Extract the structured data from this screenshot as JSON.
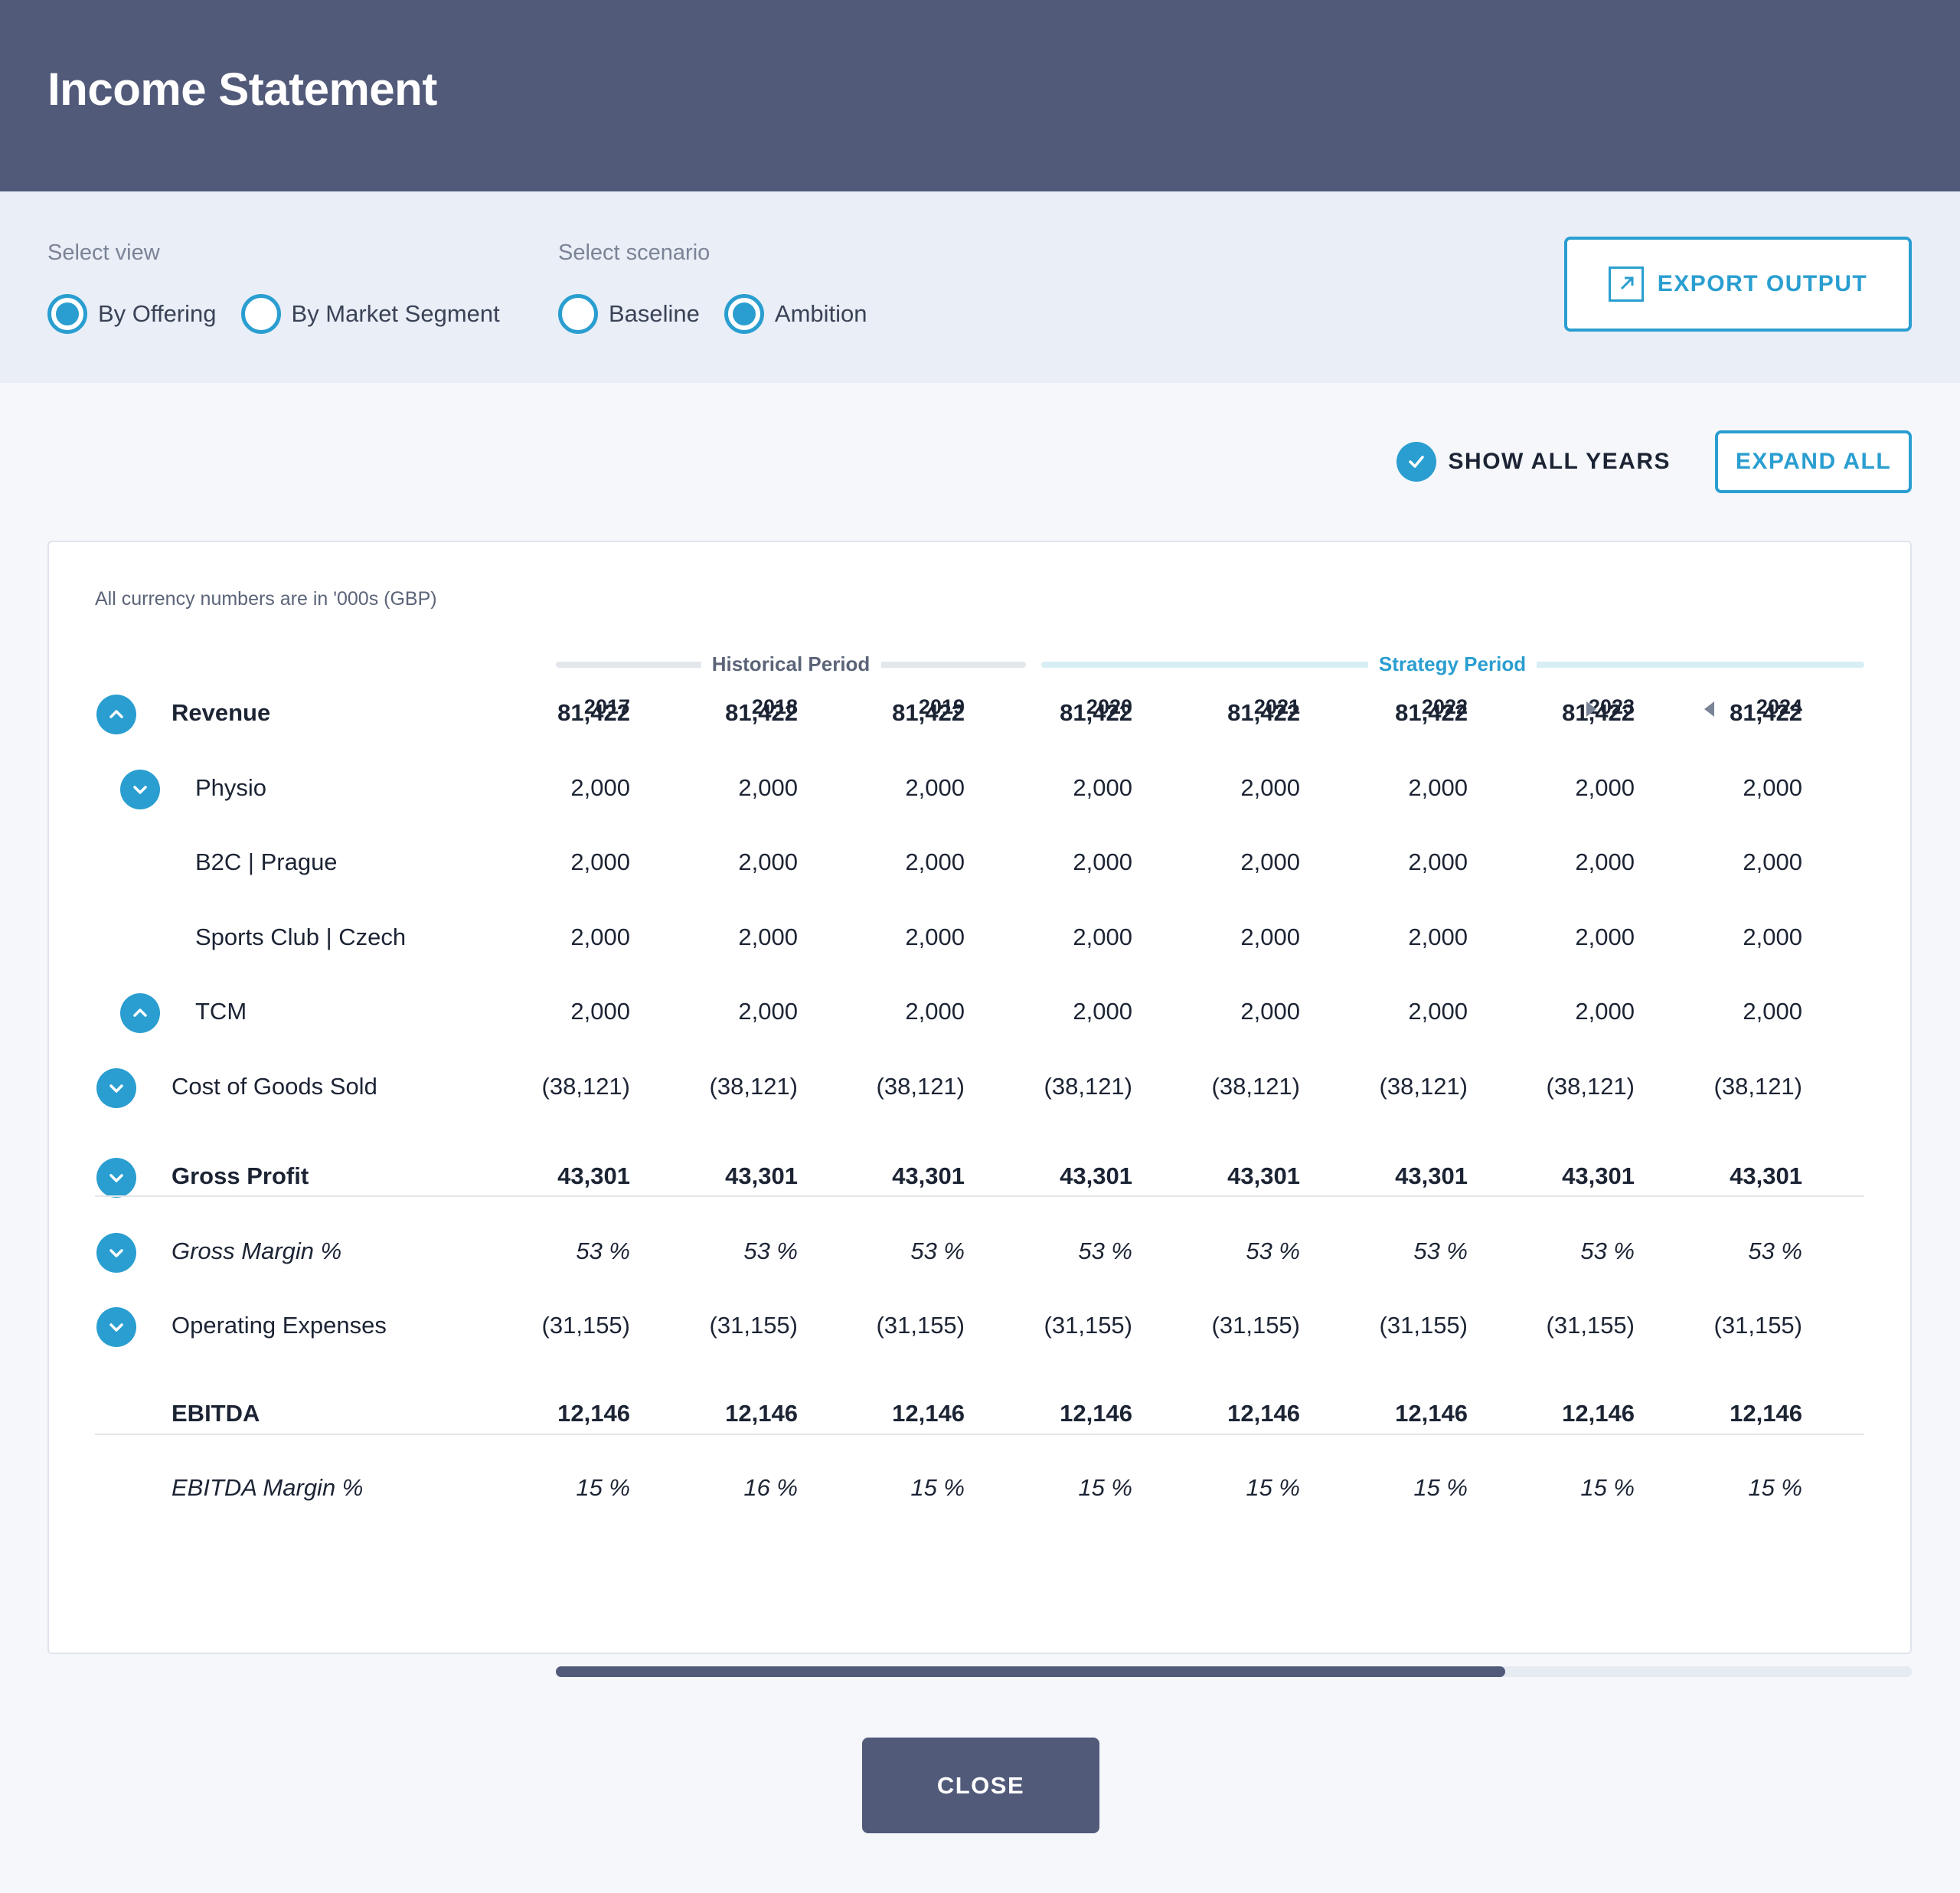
{
  "header": {
    "title": "Income Statement"
  },
  "controls": {
    "view_label": "Select view",
    "view_options": [
      {
        "label": "By Offering",
        "selected": true
      },
      {
        "label": "By Market Segment",
        "selected": false
      }
    ],
    "scenario_label": "Select scenario",
    "scenario_options": [
      {
        "label": "Baseline",
        "selected": false
      },
      {
        "label": "Ambition",
        "selected": true
      }
    ],
    "export_label": "EXPORT OUTPUT"
  },
  "toolbar": {
    "show_all_years_label": "SHOW ALL YEARS",
    "show_all_years_checked": true,
    "expand_all_label": "EXPAND ALL"
  },
  "table": {
    "currency_note": "All currency numbers are in '000s (GBP)",
    "historical_label": "Historical Period",
    "strategy_label": "Strategy Period",
    "years": [
      "2017",
      "2018",
      "2019",
      "2020",
      "2021",
      "2022",
      "2023",
      "2024"
    ],
    "rows": [
      {
        "label": "Revenue",
        "toggle": "collapse",
        "style": "bold",
        "values": [
          "81,422",
          "81,422",
          "81,422",
          "81,422",
          "81,422",
          "81,422",
          "81,422",
          "81,422"
        ]
      },
      {
        "label": "Physio",
        "toggle": "expand",
        "style": "normal",
        "values": [
          "2,000",
          "2,000",
          "2,000",
          "2,000",
          "2,000",
          "2,000",
          "2,000",
          "2,000"
        ]
      },
      {
        "label": "B2C | Prague",
        "toggle": "none",
        "style": "normal",
        "values": [
          "2,000",
          "2,000",
          "2,000",
          "2,000",
          "2,000",
          "2,000",
          "2,000",
          "2,000"
        ]
      },
      {
        "label": "Sports Club | Czech",
        "toggle": "none",
        "style": "normal",
        "values": [
          "2,000",
          "2,000",
          "2,000",
          "2,000",
          "2,000",
          "2,000",
          "2,000",
          "2,000"
        ]
      },
      {
        "label": "TCM",
        "toggle": "collapse",
        "style": "normal",
        "values": [
          "2,000",
          "2,000",
          "2,000",
          "2,000",
          "2,000",
          "2,000",
          "2,000",
          "2,000"
        ]
      },
      {
        "label": "Cost of Goods Sold",
        "toggle": "expand",
        "style": "normal",
        "values": [
          "(38,121)",
          "(38,121)",
          "(38,121)",
          "(38,121)",
          "(38,121)",
          "(38,121)",
          "(38,121)",
          "(38,121)"
        ]
      },
      {
        "label": "Gross Profit",
        "toggle": "expand",
        "style": "bold",
        "values": [
          "43,301",
          "43,301",
          "43,301",
          "43,301",
          "43,301",
          "43,301",
          "43,301",
          "43,301"
        ]
      },
      {
        "label": "Gross Margin %",
        "toggle": "expand",
        "style": "italic",
        "values": [
          "53 %",
          "53 %",
          "53 %",
          "53 %",
          "53 %",
          "53 %",
          "53 %",
          "53 %"
        ]
      },
      {
        "label": "Operating Expenses",
        "toggle": "expand",
        "style": "normal",
        "values": [
          "(31,155)",
          "(31,155)",
          "(31,155)",
          "(31,155)",
          "(31,155)",
          "(31,155)",
          "(31,155)",
          "(31,155)"
        ]
      },
      {
        "label": "EBITDA",
        "toggle": "none",
        "style": "bold",
        "values": [
          "12,146",
          "12,146",
          "12,146",
          "12,146",
          "12,146",
          "12,146",
          "12,146",
          "12,146"
        ]
      },
      {
        "label": "EBITDA Margin %",
        "toggle": "none",
        "style": "italic",
        "values": [
          "15 %",
          "16 %",
          "15 %",
          "15 %",
          "15 %",
          "15 %",
          "15 %",
          "15 %"
        ]
      }
    ]
  },
  "scroll": {
    "position_fraction": 0.7
  },
  "footer": {
    "close_label": "CLOSE"
  },
  "colors": {
    "header": "#525a7a",
    "accent": "#2a9ed0",
    "controls_bg": "#e9eef7"
  }
}
